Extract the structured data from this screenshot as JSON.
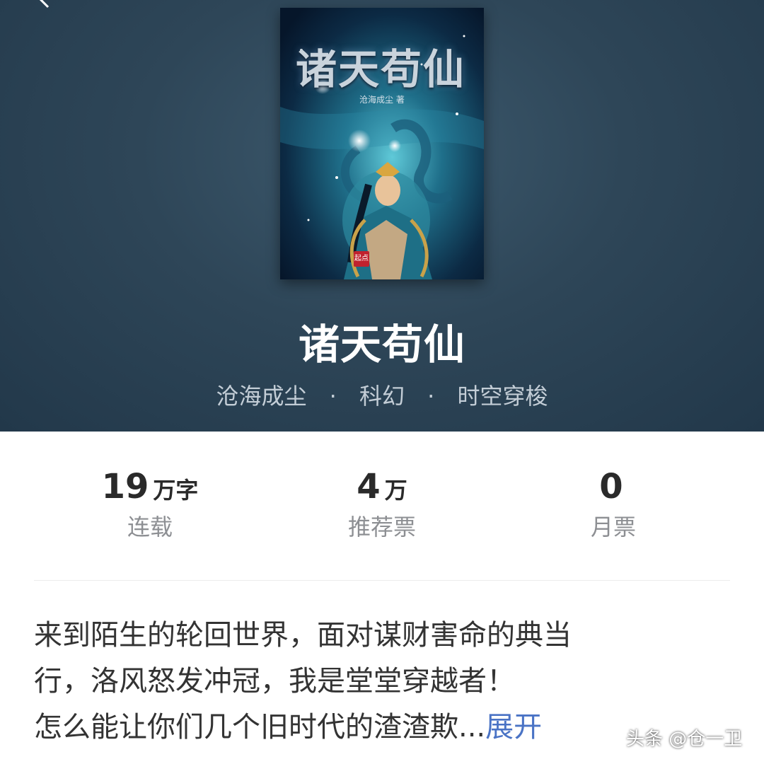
{
  "cover": {
    "title": "诸天苟仙",
    "author": "沧海成尘 著",
    "badge": "起点"
  },
  "book": {
    "title": "诸天苟仙",
    "author": "沧海成尘",
    "category": "科幻",
    "subcategory": "时空穿梭",
    "separator": "·"
  },
  "stats": [
    {
      "value": "19",
      "unit": "万字",
      "label": "连载"
    },
    {
      "value": "4",
      "unit": "万",
      "label": "推荐票"
    },
    {
      "value": "0",
      "unit": "",
      "label": "月票"
    }
  ],
  "description": {
    "lines": [
      "来到陌生的轮回世界，面对谋财害命的典当",
      "行，洛风怒发冲冠，我是堂堂穿越者！",
      "怎么能让你们几个旧时代的渣渣欺..."
    ],
    "expand_label": "展开"
  },
  "watermark": "头条 @仓一卫",
  "colors": {
    "hero_bg": "#2e4658",
    "expand_link": "#4a73c5"
  }
}
